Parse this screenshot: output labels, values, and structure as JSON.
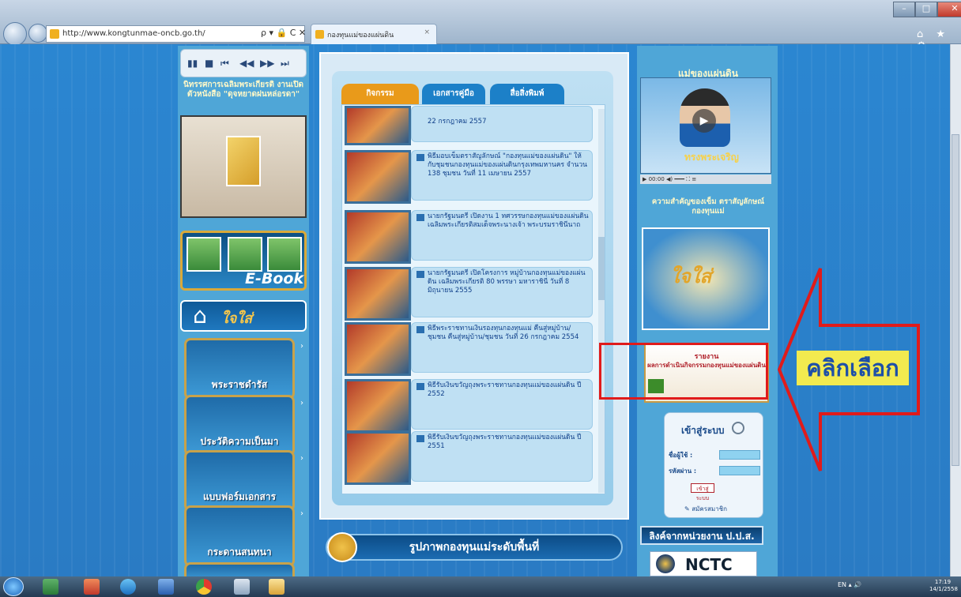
{
  "browser": {
    "address_url": "http://www.kongtunmae-oncb.go.th/",
    "address_actions": "ρ ▾ 🔒 C ✕",
    "tab_title": "กองทุนแม่ของแผ่นดิน",
    "tab_close": "×",
    "window_buttons": {
      "minimize": "–",
      "maximize": "□",
      "close": "✕"
    },
    "tool_icons": "⌂ ★ ⚙"
  },
  "left_sidebar": {
    "player_controls": [
      "▮▮",
      "■",
      "⏮",
      "◀◀",
      "▶▶",
      "⏭"
    ],
    "promo_title": "นิทรรศการเฉลิมพระเกียรติ งานเปิดตัวหนังสือ \"ดุจหยาดฝนหล่อรดา\"",
    "ebook_label": "E-Book",
    "home_logo": "ใจใส่",
    "buttons": [
      {
        "label": "พระราชดำรัส",
        "name": "sidebar-royal-speech"
      },
      {
        "label": "ประวัติความเป็นมา",
        "name": "sidebar-history"
      },
      {
        "label": "แบบฟอร์มเอกสาร",
        "name": "sidebar-forms"
      },
      {
        "label": "กระดานสนทนา",
        "name": "sidebar-webboard"
      }
    ]
  },
  "main": {
    "tabs": [
      {
        "label": "กิจกรรม",
        "color": "#e99a1a"
      },
      {
        "label": "เอกสารคู่มือ",
        "color": "#1c80c8"
      },
      {
        "label": "สื่อสิ่งพิมพ์",
        "color": "#1c80c8"
      }
    ],
    "news_items": [
      {
        "text": "22 กรกฎาคม 2557"
      },
      {
        "text": "พิธีมอบเข็มตราสัญลักษณ์ \"กองทุนแม่ของแผ่นดิน\" ให้กับชุมชนกองทุนแม่ของแผ่นดินกรุงเทพมหานคร จำนวน 138 ชุมชน วันที่ 11 เมษายน 2557"
      },
      {
        "text": "นายกรัฐมนตรี เปิดงาน 1 ทศวรรษกองทุนแม่ของแผ่นดิน เฉลิมพระเกียรติสมเด็จพระนางเจ้า พระบรมราชินีนาถ"
      },
      {
        "text": "นายกรัฐมนตรี เปิดโครงการ หมู่บ้านกองทุนแม่ของแผ่นดิน เฉลิมพระเกียรติ 80 พรรษา มหาราชินี วันที่ 8 มิถุนายน 2555"
      },
      {
        "text": "พิธีพระราชทานเงินรองทุนกองทุนแม่ คืนสู่หมู่บ้าน/ชุมชน คืนสู่หมู่บ้าน/ชุมชน วันที่ 26 กรกฎาคม 2554"
      },
      {
        "text": "พิธีรับเงินขวัญถุงพระราชทานกองทุนแม่ของแผ่นดิน ปี 2552"
      },
      {
        "text": "พิธีรับเงินขวัญถุงพระราชทานกองทุนแม่ของแผ่นดิน ปี 2551"
      }
    ],
    "bottom_banner": "รูปภาพกองทุนแม่ระดับพื้นที่"
  },
  "right_sidebar": {
    "title": "แม่ของแผ่นดิน",
    "video_caption": "ทรงพระเจริญ",
    "video_controls": "▶ 00:00 ◀) ━━━ ⛶ ≡",
    "subtitle": "ความสำคัญของเข็ม ตราสัญลักษณ์กองทุนแม่",
    "logo_text": "ใจใส่",
    "report": {
      "title": "รายงาน",
      "subtitle": "ผลการดำเนินกิจกรรมกองทุนแม่ของแผ่นดิน"
    },
    "login": {
      "title": "เข้าสู่ระบบ",
      "username_label": "ชื่อผู้ใช้ :",
      "password_label": "รหัสผ่าน :",
      "button": "เข้าสู่ระบบ",
      "register": "✎ สมัครสมาชิก"
    },
    "links_banner": "ลิงค์จากหน่วยงาน ป.ป.ส.",
    "nctc_label": "NCTC"
  },
  "callout": {
    "label": "คลิกเลือก",
    "arrow_color": "#e01b1b",
    "label_bg": "#f2ea4f"
  },
  "taskbar": {
    "tray_text": "EN ▴ 🔊",
    "clock_time": "17:19",
    "clock_date": "14/1/2558"
  }
}
